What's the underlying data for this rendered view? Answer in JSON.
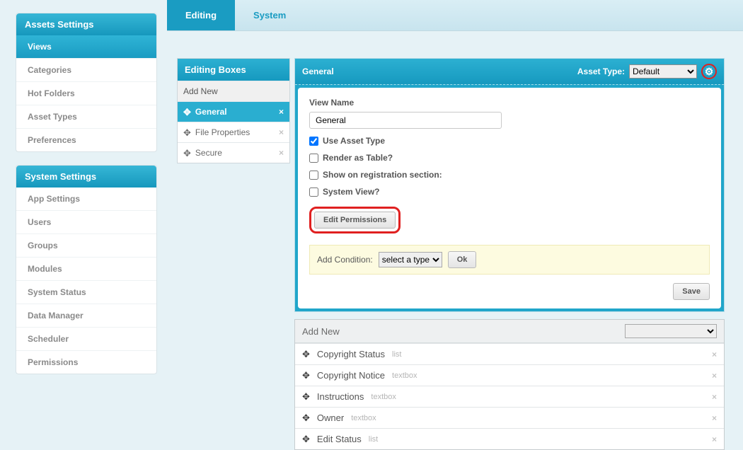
{
  "sidebar": {
    "assets_header": "Assets Settings",
    "assets_items": [
      "Views",
      "Categories",
      "Hot Folders",
      "Asset Types",
      "Preferences"
    ],
    "assets_active_index": 0,
    "system_header": "System Settings",
    "system_items": [
      "App Settings",
      "Users",
      "Groups",
      "Modules",
      "System Status",
      "Data Manager",
      "Scheduler",
      "Permissions"
    ]
  },
  "tabs": {
    "items": [
      "Editing",
      "System"
    ],
    "active_index": 0
  },
  "editing_boxes": {
    "header": "Editing Boxes",
    "add_new_label": "Add New",
    "items": [
      "General",
      "File Properties",
      "Secure"
    ],
    "selected_index": 0
  },
  "editor": {
    "title": "General",
    "asset_type_label": "Asset Type:",
    "asset_type_value": "Default",
    "view_name_label": "View Name",
    "view_name_value": "General",
    "chk_use_asset_type": {
      "label": "Use Asset Type",
      "checked": true
    },
    "chk_render_table": {
      "label": "Render as Table?",
      "checked": false
    },
    "chk_show_registration": {
      "label": "Show on registration section:",
      "checked": false
    },
    "chk_system_view": {
      "label": "System View?",
      "checked": false
    },
    "edit_permissions_label": "Edit Permissions",
    "add_condition_label": "Add Condition:",
    "condition_select_value": "select a type",
    "ok_label": "Ok",
    "save_label": "Save"
  },
  "fields": {
    "add_new_label": "Add New",
    "items": [
      {
        "name": "Copyright Status",
        "type": "list"
      },
      {
        "name": "Copyright Notice",
        "type": "textbox"
      },
      {
        "name": "Instructions",
        "type": "textbox"
      },
      {
        "name": "Owner",
        "type": "textbox"
      },
      {
        "name": "Edit Status",
        "type": "list"
      }
    ]
  }
}
